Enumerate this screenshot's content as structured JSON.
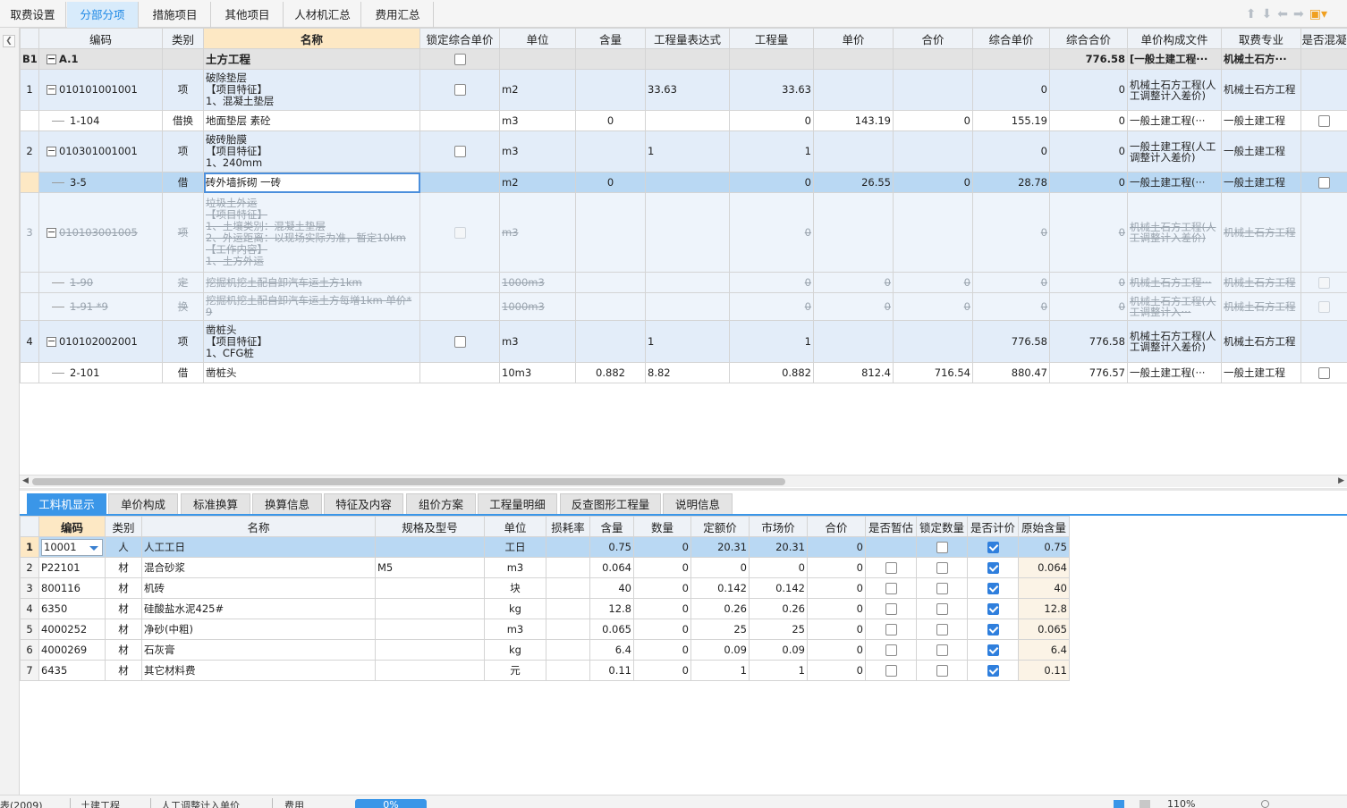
{
  "top_tabs": [
    "取费设置",
    "分部分项",
    "措施项目",
    "其他项目",
    "人材机汇总",
    "费用汇总"
  ],
  "toolbar_icons": [
    "arrow-up-icon",
    "arrow-down-icon",
    "arrow-left-icon",
    "arrow-right-icon",
    "paint-brush-icon"
  ],
  "main_headers": [
    "",
    "编码",
    "类别",
    "名称",
    "锁定综合单价",
    "单位",
    "含量",
    "工程量表达式",
    "工程量",
    "单价",
    "合价",
    "综合单价",
    "综合合价",
    "单价构成文件",
    "取费专业",
    "是否混凝"
  ],
  "main_rows": [
    {
      "idx": "B1",
      "code": "A.1",
      "type": "",
      "name": "土方工程",
      "unit": "",
      "content": "",
      "expr": "",
      "qty": "",
      "price": "",
      "total": "",
      "comp_price": "",
      "comp_total": "776.58",
      "file": "[一般土建工程···",
      "spec": "机械土石方···"
    },
    {
      "idx": "1",
      "code": "010101001001",
      "type": "项",
      "name": "破除垫层\n【项目特征】\n1、混凝土垫层",
      "unit": "m2",
      "content": "",
      "expr": "33.63",
      "qty": "33.63",
      "price": "",
      "total": "",
      "comp_price": "0",
      "comp_total": "0",
      "file": "机械土石方工程(人工调整计入差价)",
      "spec": "机械土石方工程"
    },
    {
      "idx": "",
      "code": "1-104",
      "type": "借换",
      "name": "地面垫层 素砼",
      "unit": "m3",
      "content": "0",
      "expr": "",
      "qty": "0",
      "price": "143.19",
      "total": "0",
      "comp_price": "155.19",
      "comp_total": "0",
      "file": "一般土建工程(···",
      "spec": "一般土建工程"
    },
    {
      "idx": "2",
      "code": "010301001001",
      "type": "项",
      "name": "破砖胎膜\n【项目特征】\n1、240mm",
      "unit": "m3",
      "content": "",
      "expr": "1",
      "qty": "1",
      "price": "",
      "total": "",
      "comp_price": "0",
      "comp_total": "0",
      "file": "一般土建工程(人工调整计入差价)",
      "spec": "一般土建工程"
    },
    {
      "idx": "",
      "code": "3-5",
      "type": "借",
      "name": "砖外墙拆砌 一砖",
      "unit": "m2",
      "content": "0",
      "expr": "",
      "qty": "0",
      "price": "26.55",
      "total": "0",
      "comp_price": "28.78",
      "comp_total": "0",
      "file": "一般土建工程(···",
      "spec": "一般土建工程"
    },
    {
      "idx": "3",
      "code": "010103001005",
      "type": "项",
      "name": "垃圾土外运\n【项目特征】\n1、土壤类别：混凝土垫层\n2、外运距离：以现场实际为准，暂定10km\n【工作内容】\n1、土方外运",
      "unit": "m3",
      "content": "",
      "expr": "",
      "qty": "0",
      "price": "",
      "total": "",
      "comp_price": "0",
      "comp_total": "0",
      "file": "机械土石方工程(人工调整计入差价)",
      "spec": "机械土石方工程"
    },
    {
      "idx": "",
      "code": "1-90",
      "type": "定",
      "name": "挖掘机挖土配自卸汽车运土方1km",
      "unit": "1000m3",
      "content": "",
      "expr": "",
      "qty": "0",
      "price": "0",
      "total": "0",
      "comp_price": "0",
      "comp_total": "0",
      "file": "机械土石方工程···",
      "spec": "机械土石方工程"
    },
    {
      "idx": "",
      "code": "1-91 *9",
      "type": "换",
      "name": "挖掘机挖土配自卸汽车运土方每增1km 单价*9",
      "unit": "1000m3",
      "content": "",
      "expr": "",
      "qty": "0",
      "price": "0",
      "total": "0",
      "comp_price": "0",
      "comp_total": "0",
      "file": "机械土石方工程(人工调整计入···",
      "spec": "机械土石方工程"
    },
    {
      "idx": "4",
      "code": "010102002001",
      "type": "项",
      "name": "凿桩头\n【项目特征】\n1、CFG桩",
      "unit": "m3",
      "content": "",
      "expr": "1",
      "qty": "1",
      "price": "",
      "total": "",
      "comp_price": "776.58",
      "comp_total": "776.58",
      "file": "机械土石方工程(人工调整计入差价)",
      "spec": "机械土石方工程"
    },
    {
      "idx": "",
      "code": "2-101",
      "type": "借",
      "name": "凿桩头",
      "unit": "10m3",
      "content": "0.882",
      "expr": "8.82",
      "qty": "0.882",
      "price": "812.4",
      "total": "716.54",
      "comp_price": "880.47",
      "comp_total": "776.57",
      "file": "一般土建工程(···",
      "spec": "一般土建工程"
    }
  ],
  "bottom_tabs": [
    "工料机显示",
    "单价构成",
    "标准换算",
    "换算信息",
    "特征及内容",
    "组价方案",
    "工程量明细",
    "反查图形工程量",
    "说明信息"
  ],
  "res_headers": [
    "",
    "编码",
    "类别",
    "名称",
    "规格及型号",
    "单位",
    "损耗率",
    "含量",
    "数量",
    "定额价",
    "市场价",
    "合价",
    "是否暂估",
    "锁定数量",
    "是否计价",
    "原始含量"
  ],
  "res_rows": [
    {
      "idx": "1",
      "code": "10001",
      "type": "人",
      "name": "人工工日",
      "spec": "",
      "unit": "工日",
      "loss": "",
      "content": "0.75",
      "qty": "0",
      "quota": "20.31",
      "market": "20.31",
      "total": "0",
      "orig": "0.75",
      "est": null,
      "lock": false,
      "priced": true
    },
    {
      "idx": "2",
      "code": "P22101",
      "type": "材",
      "name": "混合砂浆",
      "spec": "M5",
      "unit": "m3",
      "loss": "",
      "content": "0.064",
      "qty": "0",
      "quota": "0",
      "market": "0",
      "total": "0",
      "orig": "0.064",
      "est": false,
      "lock": false,
      "priced": true
    },
    {
      "idx": "3",
      "code": "800116",
      "type": "材",
      "name": "机砖",
      "spec": "",
      "unit": "块",
      "loss": "",
      "content": "40",
      "qty": "0",
      "quota": "0.142",
      "market": "0.142",
      "total": "0",
      "orig": "40",
      "est": false,
      "lock": false,
      "priced": true
    },
    {
      "idx": "4",
      "code": "6350",
      "type": "材",
      "name": "硅酸盐水泥425#",
      "spec": "",
      "unit": "kg",
      "loss": "",
      "content": "12.8",
      "qty": "0",
      "quota": "0.26",
      "market": "0.26",
      "total": "0",
      "orig": "12.8",
      "est": false,
      "lock": false,
      "priced": true
    },
    {
      "idx": "5",
      "code": "4000252",
      "type": "材",
      "name": "净砂(中粗)",
      "spec": "",
      "unit": "m3",
      "loss": "",
      "content": "0.065",
      "qty": "0",
      "quota": "25",
      "market": "25",
      "total": "0",
      "orig": "0.065",
      "est": false,
      "lock": false,
      "priced": true
    },
    {
      "idx": "6",
      "code": "4000269",
      "type": "材",
      "name": "石灰膏",
      "spec": "",
      "unit": "kg",
      "loss": "",
      "content": "6.4",
      "qty": "0",
      "quota": "0.09",
      "market": "0.09",
      "total": "0",
      "orig": "6.4",
      "est": false,
      "lock": false,
      "priced": true
    },
    {
      "idx": "7",
      "code": "6435",
      "type": "材",
      "name": "其它材料费",
      "spec": "",
      "unit": "元",
      "loss": "",
      "content": "0.11",
      "qty": "0",
      "quota": "1",
      "market": "1",
      "total": "0",
      "orig": "0.11",
      "est": false,
      "lock": false,
      "priced": true
    }
  ],
  "status": {
    "s1": "表(2009)",
    "s2": "土建工程",
    "s3": "人工调整计入单价",
    "s4": "费用",
    "s5": "0%",
    "zoom": "110%"
  }
}
